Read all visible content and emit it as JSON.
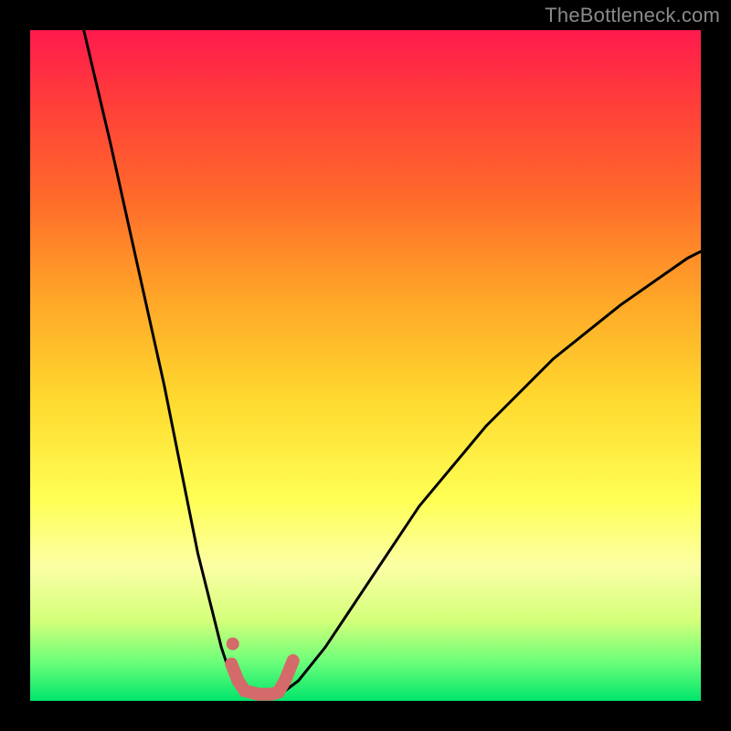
{
  "watermark": "TheBottleneck.com",
  "chart_data": {
    "type": "line",
    "title": "",
    "xlabel": "",
    "ylabel": "",
    "xlim": [
      0,
      100
    ],
    "ylim": [
      0,
      100
    ],
    "grid": false,
    "legend": false,
    "series": [
      {
        "name": "left-curve",
        "x": [
          8,
          12,
          16,
          20,
          23,
          25,
          27,
          28.5,
          29.5,
          30.5,
          31,
          31.5
        ],
        "y": [
          100,
          83,
          65,
          47,
          32,
          22,
          14,
          8,
          5,
          3,
          2,
          1.2
        ],
        "color": "#000000"
      },
      {
        "name": "right-curve",
        "x": [
          38,
          40,
          44,
          50,
          58,
          68,
          78,
          88,
          98,
          100
        ],
        "y": [
          1.5,
          3,
          8,
          17,
          29,
          41,
          51,
          59,
          66,
          67
        ],
        "color": "#000000"
      },
      {
        "name": "marker-dot",
        "x": [
          30.2
        ],
        "y": [
          8.5
        ],
        "color": "#d46a6a"
      },
      {
        "name": "bottom-accent",
        "x": [
          30,
          31,
          32,
          34,
          36,
          37,
          38,
          39.2
        ],
        "y": [
          5.5,
          3,
          1.5,
          1,
          1,
          1.3,
          3,
          6
        ],
        "color": "#d46a6a"
      }
    ],
    "colors": {
      "gradient_top": "#ff1a4d",
      "gradient_mid": "#ffff55",
      "gradient_bottom": "#00e56b",
      "curve": "#000000",
      "accent": "#d46a6a",
      "frame": "#000000"
    }
  }
}
